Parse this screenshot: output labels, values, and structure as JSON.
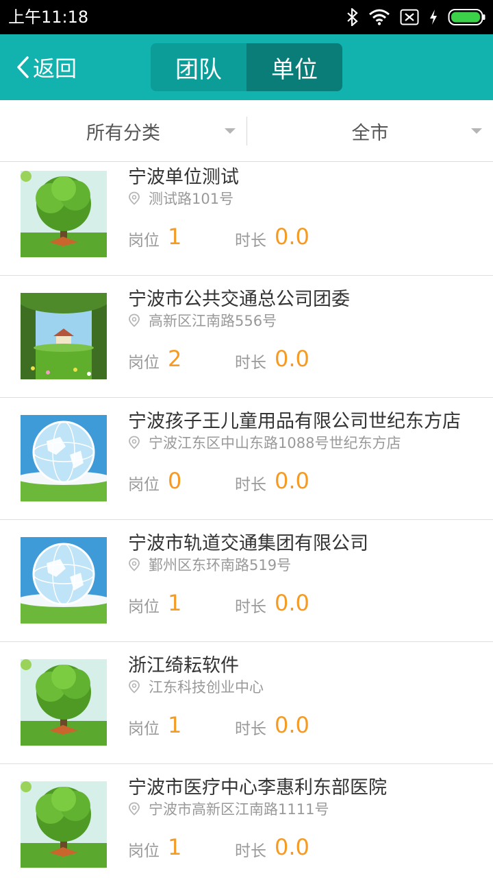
{
  "status_bar": {
    "time": "上午11:18"
  },
  "nav": {
    "back_label": "返回",
    "tabs": [
      {
        "label": "团队"
      },
      {
        "label": "单位"
      }
    ],
    "active_tab": "单位"
  },
  "filters": {
    "category": "所有分类",
    "region": "全市"
  },
  "colors": {
    "primary": "#12b3ae",
    "accent": "#f59a23"
  },
  "list": {
    "position_label": "岗位",
    "duration_label": "时长",
    "items": [
      {
        "name": "宁波单位测试",
        "address": "测试路101号",
        "positions": "1",
        "duration": "0.0",
        "image": "tree"
      },
      {
        "name": "宁波市公共交通总公司团委",
        "address": "高新区江南路556号",
        "positions": "2",
        "duration": "0.0",
        "image": "meadow-house"
      },
      {
        "name": "宁波孩子王儿童用品有限公司世纪东方店",
        "address": "宁波江东区中山东路1088号世纪东方店",
        "positions": "0",
        "duration": "0.0",
        "image": "globe"
      },
      {
        "name": "宁波市轨道交通集团有限公司",
        "address": "鄞州区东环南路519号",
        "positions": "1",
        "duration": "0.0",
        "image": "globe"
      },
      {
        "name": "浙江绮耘软件",
        "address": "江东科技创业中心",
        "positions": "1",
        "duration": "0.0",
        "image": "tree"
      },
      {
        "name": "宁波市医疗中心李惠利东部医院",
        "address": "宁波市高新区江南路1111号",
        "positions": "1",
        "duration": "0.0",
        "image": "tree"
      }
    ]
  }
}
